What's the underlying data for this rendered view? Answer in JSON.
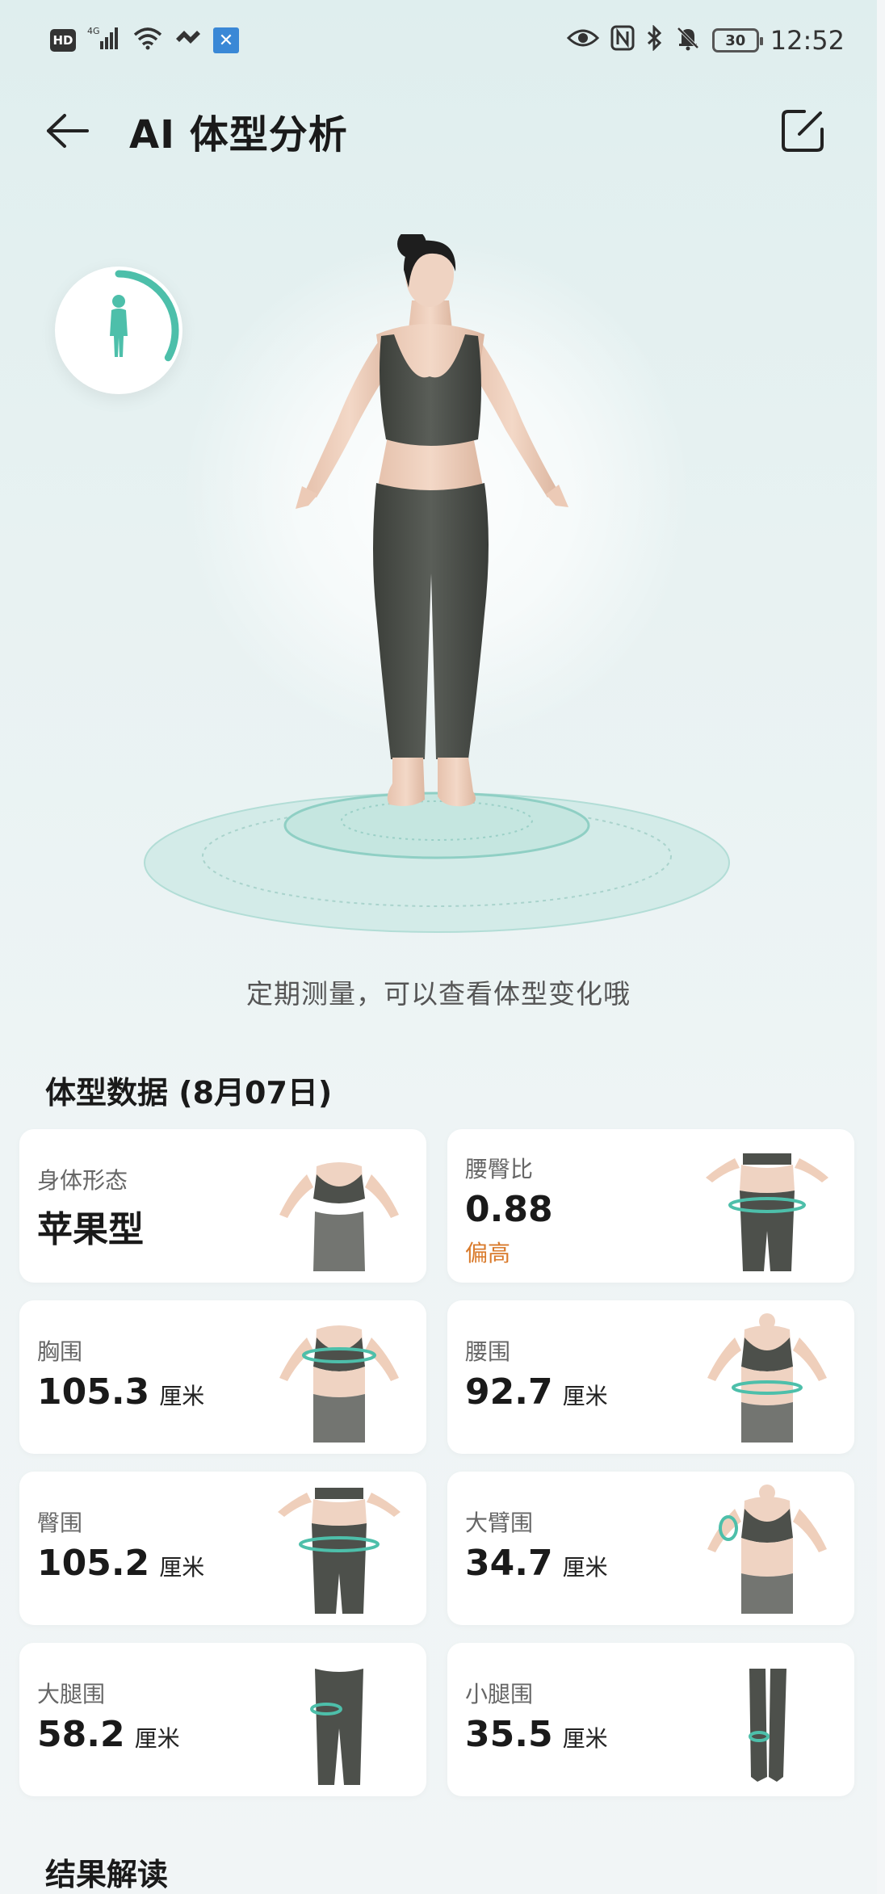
{
  "status_bar": {
    "hd": "HD",
    "network": "4G",
    "battery": "30",
    "time": "12:52"
  },
  "header": {
    "title": "AI 体型分析",
    "back_icon": "arrow-left-icon",
    "edit_icon": "edit-square-icon"
  },
  "hero": {
    "progress_ratio": 0.33,
    "accent": "#4dbfaa",
    "hint": "定期测量，可以查看体型变化哦"
  },
  "body_data": {
    "title": "体型数据 (8月07日)",
    "cards": [
      {
        "label": "身体形态",
        "value": "苹果型",
        "unit": "",
        "note": ""
      },
      {
        "label": "腰臀比",
        "value": "0.88",
        "unit": "",
        "note": "偏高"
      },
      {
        "label": "胸围",
        "value": "105.3",
        "unit": "厘米",
        "note": ""
      },
      {
        "label": "腰围",
        "value": "92.7",
        "unit": "厘米",
        "note": ""
      },
      {
        "label": "臀围",
        "value": "105.2",
        "unit": "厘米",
        "note": ""
      },
      {
        "label": "大臂围",
        "value": "34.7",
        "unit": "厘米",
        "note": ""
      },
      {
        "label": "大腿围",
        "value": "58.2",
        "unit": "厘米",
        "note": ""
      },
      {
        "label": "小腿围",
        "value": "35.5",
        "unit": "厘米",
        "note": ""
      }
    ]
  },
  "result": {
    "title": "结果解读"
  },
  "colors": {
    "teal": "#4dbfaa",
    "warning": "#d97a2b",
    "garment": "#4a4d48",
    "skin": "#f1d2bf"
  }
}
